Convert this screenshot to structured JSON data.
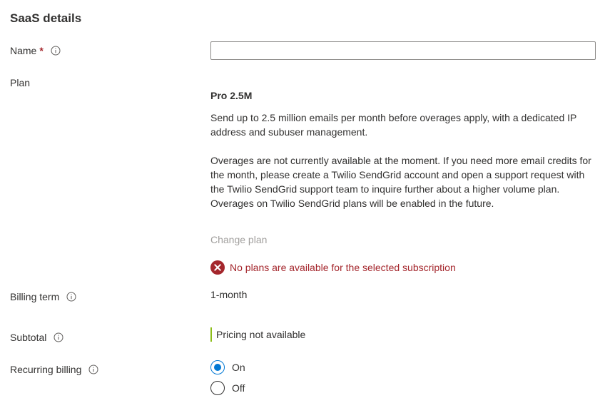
{
  "section": {
    "title": "SaaS details"
  },
  "name_field": {
    "label": "Name",
    "required_marker": "*",
    "info_icon": "info-icon",
    "value": "",
    "placeholder": ""
  },
  "plan": {
    "label": "Plan",
    "name": "Pro 2.5M",
    "description": "Send up to 2.5 million emails per month before overages apply, with a dedicated IP address and subuser management.",
    "overage_note": "Overages are not currently available at the moment. If you need more email credits for the month, please create a Twilio SendGrid account and open a support request with the Twilio SendGrid support team to inquire further about a higher volume plan. Overages on Twilio SendGrid plans will be enabled in the future.",
    "change_plan_label": "Change plan",
    "error_icon": "error-circle-icon",
    "error_message": "No plans are available for the selected subscription"
  },
  "billing_term": {
    "label": "Billing term",
    "info_icon": "info-icon",
    "value": "1-month"
  },
  "subtotal": {
    "label": "Subtotal",
    "info_icon": "info-icon",
    "value": "Pricing not available"
  },
  "recurring_billing": {
    "label": "Recurring billing",
    "info_icon": "info-icon",
    "options": [
      {
        "label": "On",
        "checked": true
      },
      {
        "label": "Off",
        "checked": false
      }
    ]
  },
  "colors": {
    "accent": "#0078d4",
    "error": "#a4262c",
    "disabled_text": "#a19f9d",
    "pricing_bar": "#8cbd18",
    "text": "#323130"
  }
}
